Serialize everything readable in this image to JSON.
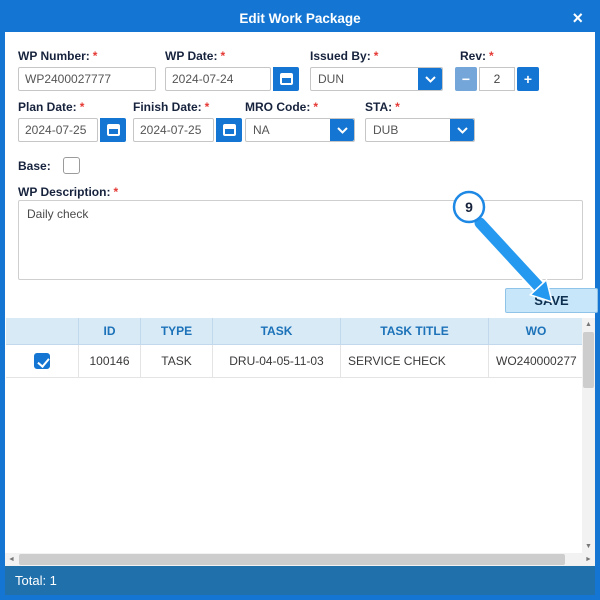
{
  "colors": {
    "primary": "#1476d2",
    "footer_bg": "#2070ab",
    "table_header_bg": "#d9eaf7",
    "table_header_text": "#1b72b8",
    "required_marker_color": "#e53935",
    "annotation_blue": "#2499ef",
    "save_button_bg": "#c8e6fa"
  },
  "dialog": {
    "title": "Edit Work Package",
    "close_label": "×"
  },
  "form": {
    "required_marker": "*",
    "wp_number": {
      "label": "WP Number:",
      "value": "WP2400027777"
    },
    "wp_date": {
      "label": "WP Date:",
      "value": "2024-07-24"
    },
    "issued_by": {
      "label": "Issued By:",
      "value": "DUN"
    },
    "rev": {
      "label": "Rev:",
      "minus": "−",
      "value": "2",
      "plus": "+"
    },
    "plan_date": {
      "label": "Plan Date:",
      "value": "2024-07-25"
    },
    "finish_date": {
      "label": "Finish Date:",
      "value": "2024-07-25"
    },
    "mro_code": {
      "label": "MRO Code:",
      "value": "NA"
    },
    "sta": {
      "label": "STA:",
      "value": "DUB"
    },
    "base": {
      "label": "Base:"
    },
    "wp_description": {
      "label": "WP Description:",
      "value": "Daily check"
    }
  },
  "actions": {
    "save_label": "SAVE"
  },
  "annotation": {
    "step_number": "9"
  },
  "table": {
    "headers": {
      "id": "ID",
      "type": "TYPE",
      "task": "TASK",
      "task_title": "TASK TITLE",
      "wo": "WO"
    },
    "rows": [
      {
        "checked": true,
        "id": "100146",
        "type": "TASK",
        "task": "DRU-04-05-11-03",
        "task_title": "SERVICE CHECK",
        "wo": "WO240000277"
      }
    ]
  },
  "icons": {
    "arrow_up": "▲",
    "arrow_down": "▼",
    "arrow_left": "◄",
    "arrow_right": "►"
  },
  "footer": {
    "total": "Total: 1"
  }
}
